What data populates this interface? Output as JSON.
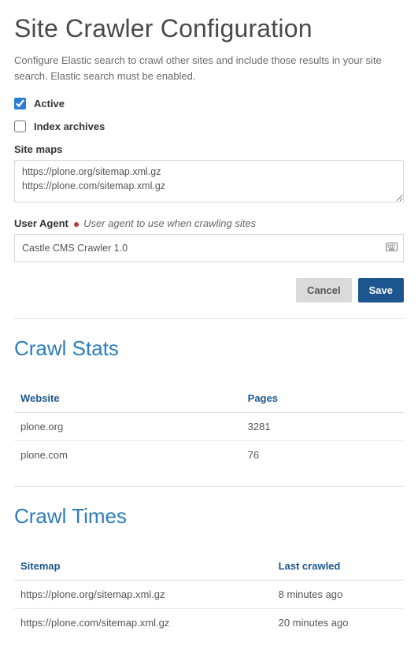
{
  "page": {
    "title": "Site Crawler Configuration",
    "description": "Configure Elastic search to crawl other sites and include those results in your site search. Elastic search must be enabled."
  },
  "form": {
    "active_label": "Active",
    "active_checked": true,
    "index_archives_label": "Index archives",
    "index_archives_checked": false,
    "sitemaps_label": "Site maps",
    "sitemaps_value": "https://plone.org/sitemap.xml.gz\nhttps://plone.com/sitemap.xml.gz",
    "user_agent_label": "User Agent",
    "user_agent_hint": "User agent to use when crawling sites",
    "user_agent_value": "Castle CMS Crawler 1.0",
    "cancel_label": "Cancel",
    "save_label": "Save"
  },
  "crawl_stats": {
    "heading": "Crawl Stats",
    "col_website": "Website",
    "col_pages": "Pages",
    "rows": [
      {
        "website": "plone.org",
        "pages": "3281"
      },
      {
        "website": "plone.com",
        "pages": "76"
      }
    ]
  },
  "crawl_times": {
    "heading": "Crawl Times",
    "col_sitemap": "Sitemap",
    "col_last_crawled": "Last crawled",
    "rows": [
      {
        "sitemap": "https://plone.org/sitemap.xml.gz",
        "last_crawled": "8 minutes ago"
      },
      {
        "sitemap": "https://plone.com/sitemap.xml.gz",
        "last_crawled": "20 minutes ago"
      }
    ]
  }
}
